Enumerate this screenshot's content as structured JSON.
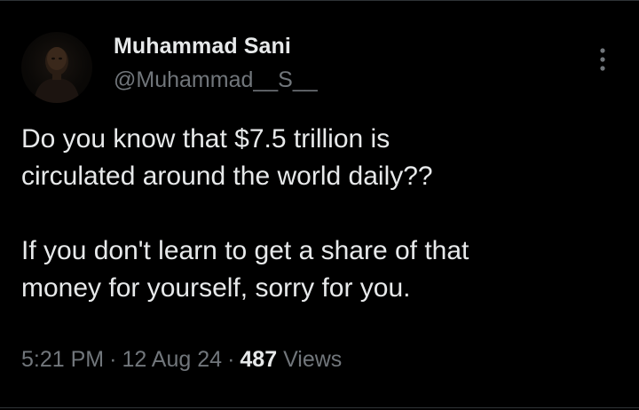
{
  "author": {
    "display_name": "Muhammad Sani",
    "handle": "@Muhammad__S__",
    "avatar_icon": "profile-photo-avatar"
  },
  "menu": {
    "icon": "more-vertical-icon"
  },
  "tweet": {
    "paragraphs": [
      {
        "lines": [
          "Do you know that $7.5 trillion is",
          "circulated around the world daily??"
        ]
      },
      {
        "lines": [
          "If you don't learn to get a share of that",
          "money for yourself, sorry for you."
        ]
      }
    ]
  },
  "meta": {
    "time": "5:21 PM",
    "separator": "·",
    "date": "12 Aug 24",
    "views_count": "487",
    "views_label": "Views"
  },
  "colors": {
    "background": "#000000",
    "primary_text": "#e7e9ea",
    "secondary_text": "#71767b",
    "divider": "#2f3336"
  }
}
